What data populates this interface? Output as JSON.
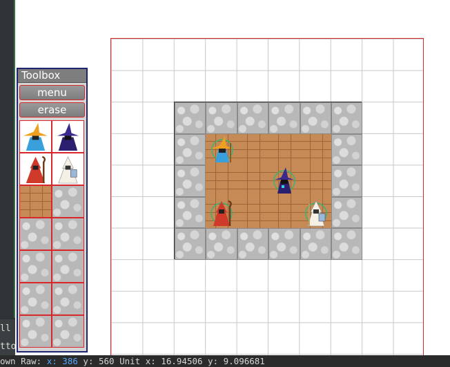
{
  "left_panel": {
    "fragment_1": "ll",
    "fragment_2": "tto"
  },
  "toolbox": {
    "title": "Toolbox",
    "menu_label": "menu",
    "erase_label": "erase",
    "palette": [
      "wizard-orange",
      "wizard-purple",
      "wizard-red",
      "wizard-white",
      "floor-wood",
      "wall-stone",
      "wall-stone",
      "wall-stone",
      "wall-stone",
      "wall-stone",
      "wall-stone",
      "wall-stone",
      "wall-stone",
      "wall-stone"
    ]
  },
  "map": {
    "units": [
      "wizard-orange",
      "wizard-purple",
      "wizard-red",
      "wizard-white"
    ]
  },
  "status": {
    "prefix": "own Raw: ",
    "raw_x": "x: 386",
    "raw_y_label": " y",
    "rest": ": 560 Unit x: 16.94506 y: 9.096681"
  },
  "colors": {
    "canvas_border": "#d9262b",
    "toolbox_border": "#20246f",
    "status_bg": "#2b2b2b",
    "highlight": "#58a6ff"
  }
}
